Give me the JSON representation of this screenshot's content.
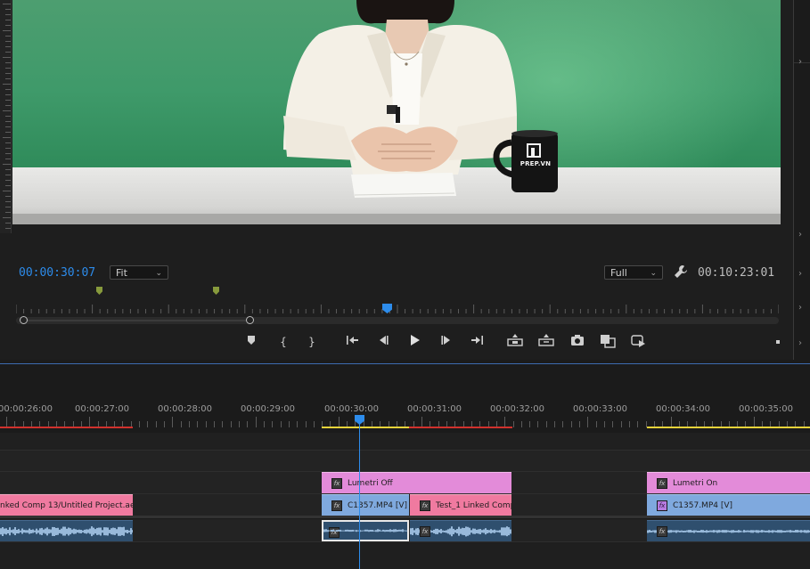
{
  "monitor": {
    "current_timecode": "00:00:30:07",
    "zoom": "Fit",
    "resolution": "Full",
    "duration": "00:10:23:01",
    "mug_logo_text": "PREP.VN"
  },
  "transport": {
    "buttons": [
      "add-marker-icon",
      "mark-in-icon",
      "mark-out-icon",
      "go-to-in-icon",
      "step-back-icon",
      "play-icon",
      "step-forward-icon",
      "go-to-out-icon",
      "lift-icon",
      "extract-icon",
      "export-frame-icon",
      "compare-view-icon",
      "vr-video-icon",
      "more-icon"
    ]
  },
  "timeline": {
    "ruler_labels": [
      "00:00:26:00",
      "00:00:27:00",
      "00:00:28:00",
      "00:00:29:00",
      "00:00:30:00",
      "00:00:31:00",
      "00:00:32:00",
      "00:00:33:00",
      "00:00:34:00",
      "00:00:35:00"
    ],
    "clips": {
      "v3_lumetri_off": "Lumetri Off",
      "v3_lumetri_on": "Lumetri On",
      "v2_linked_comp": "nked Comp 13/Untitled Project.aep",
      "v2_c1357_a": "C1357.MP4 [V]",
      "v2_test_linked": "Test_1 Linked Comp",
      "v2_c1357_b": "C1357.MP4 [V]"
    },
    "fx_label": "fx",
    "colors": {
      "adjustment_clip": "#e38bd9",
      "linked_comp_clip": "#f07aa0",
      "video_clip": "#7fa9de",
      "audio_clip": "#2f4f6e",
      "playhead": "#2d8ceb",
      "render_red": "#d0312d",
      "render_yellow": "#e7d33a"
    }
  }
}
